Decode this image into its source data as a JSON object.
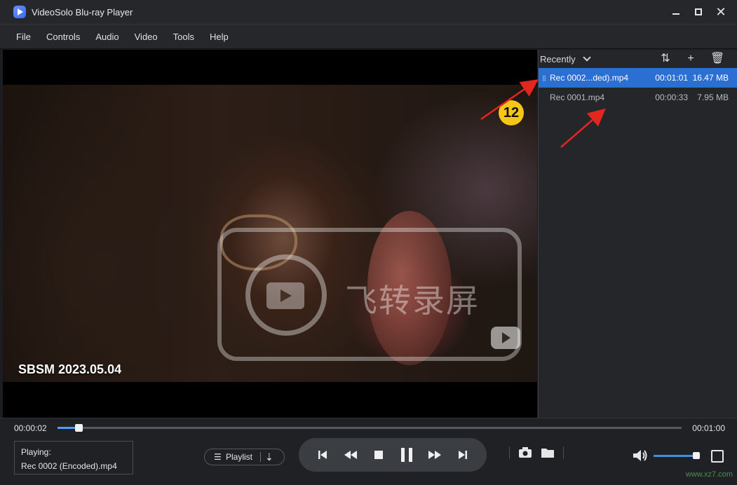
{
  "window": {
    "title": "VideoSolo Blu-ray Player"
  },
  "menu": [
    "File",
    "Controls",
    "Audio",
    "Video",
    "Tools",
    "Help"
  ],
  "video": {
    "caption": "SBSM 2023.05.04",
    "watermark_text": "飞转录屏",
    "annotation_badge": "12"
  },
  "playlist_panel": {
    "sort_label": "Recently",
    "items": [
      {
        "state": "||",
        "name": "Rec 0002...ded).mp4",
        "duration": "00:01:01",
        "size": "16.47 MB",
        "active": true
      },
      {
        "state": "",
        "name": "Rec 0001.mp4",
        "duration": "00:00:33",
        "size": "7.95 MB",
        "active": false
      }
    ]
  },
  "controls": {
    "current_time": "00:00:02",
    "total_time": "00:01:00",
    "progress": 0.034,
    "volume": 1.0,
    "now_playing_label": "Playing:",
    "now_playing_file": "Rec 0002 (Encoded).mp4",
    "playlist_button_label": "Playlist",
    "site_watermark": "www.xz7.com"
  },
  "colors": {
    "accent": "#2b6fd2",
    "progress": "#49a0ff",
    "badge": "#f5c518",
    "annotation_arrow": "#e3261e"
  }
}
